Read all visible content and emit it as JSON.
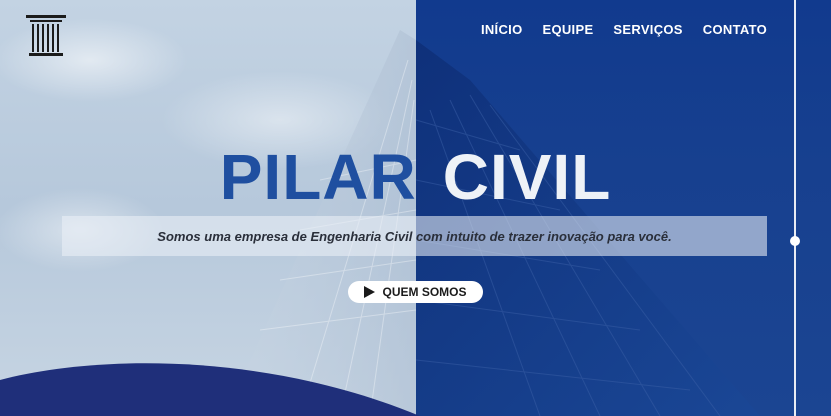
{
  "brand": {
    "title_word1": "PILAR",
    "title_word2": "CIVIL"
  },
  "nav": {
    "items": [
      "INÍCIO",
      "EQUIPE",
      "SERVIÇOS",
      "CONTATO"
    ]
  },
  "hero": {
    "tagline": "Somos uma empresa de Engenharia Civil com intuito de trazer inovação para você.",
    "cta_label": "QUEM SOMOS"
  },
  "icons": {
    "logo": "column-pillar-icon",
    "cta": "play-icon"
  },
  "colors": {
    "primary_blue": "#1f4fa0",
    "dark_blue": "#113a8e",
    "navy_wave": "#1f2f7a",
    "white": "#ffffff"
  }
}
